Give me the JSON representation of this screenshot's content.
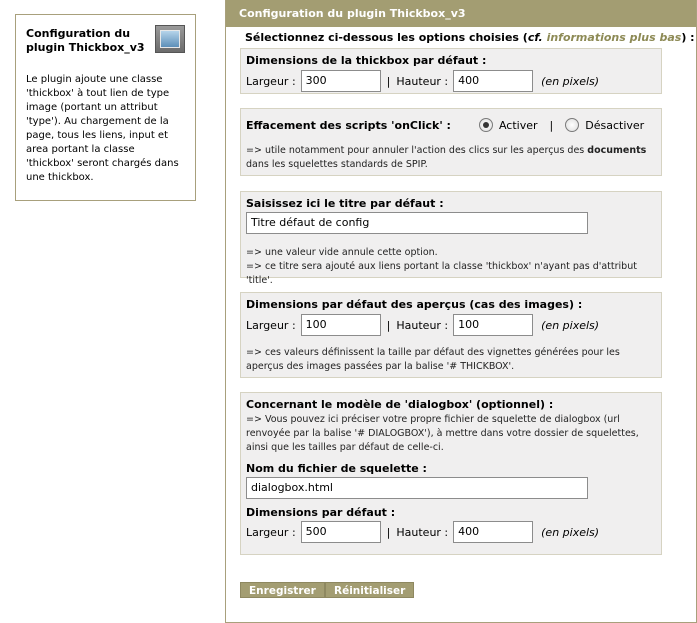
{
  "sidebar": {
    "title": "Configuration du plugin Thickbox_v3",
    "description": "Le plugin ajoute une classe 'thickbox' à tout lien de type image (portant un attribut 'type'). Au chargement de la page, tous les liens, input et area portant la classe 'thickbox' seront chargés dans une thickbox.",
    "icon": "plugin-screen-icon"
  },
  "panel": {
    "title": "Configuration du plugin Thickbox_v3",
    "intro_prefix": "Sélectionnez ci-dessous les options choisies (",
    "intro_cf": "cf.",
    "intro_link": "informations plus bas",
    "intro_suffix": ") :"
  },
  "dims": {
    "legend": "Dimensions de la thickbox par défaut :",
    "width_label": "Largeur :",
    "width_value": "300",
    "sep": "|",
    "height_label": "Hauteur :",
    "height_value": "400",
    "unit": "(en pixels)"
  },
  "onclick": {
    "legend": "Effacement des scripts 'onClick' :",
    "option_on": "Activer",
    "sep": "|",
    "option_off": "Désactiver",
    "selected": "Activer",
    "note_prefix": "=> utile notamment pour annuler l'action des clics sur les aperçus des ",
    "note_bold": "documents",
    "note_suffix": " dans les squelettes standards de SPIP."
  },
  "title_field": {
    "legend": "Saisissez ici le titre par défaut :",
    "value": "Titre défaut de config",
    "note1": "=> une valeur vide annule cette option.",
    "note2": "=> ce titre sera ajouté aux liens portant la classe 'thickbox' n'ayant pas d'attribut 'title'."
  },
  "preview_dims": {
    "legend": "Dimensions par défaut des aperçus (cas des images) :",
    "width_label": "Largeur :",
    "width_value": "100",
    "sep": "|",
    "height_label": "Hauteur :",
    "height_value": "100",
    "unit": "(en pixels)",
    "note": "=> ces valeurs définissent la taille par défaut des vignettes générées pour les aperçus des images passées par la balise '# THICKBOX'."
  },
  "dialog": {
    "legend": "Concernant le modèle de 'dialogbox' (optionnel) :",
    "note": "=> Vous pouvez ici préciser votre propre fichier de squelette de dialogbox (url renvoyée par la balise '# DIALOGBOX'), à mettre dans votre dossier de squelettes, ainsi que les tailles par défaut de celle-ci.",
    "file_label": "Nom du fichier de squelette :",
    "file_value": "dialogbox.html",
    "dims_label": "Dimensions par défaut :",
    "width_label": "Largeur :",
    "width_value": "500",
    "sep": "|",
    "height_label": "Hauteur :",
    "height_value": "400",
    "unit": "(en pixels)"
  },
  "buttons": {
    "save": "Enregistrer",
    "reset": "Réinitialiser"
  }
}
